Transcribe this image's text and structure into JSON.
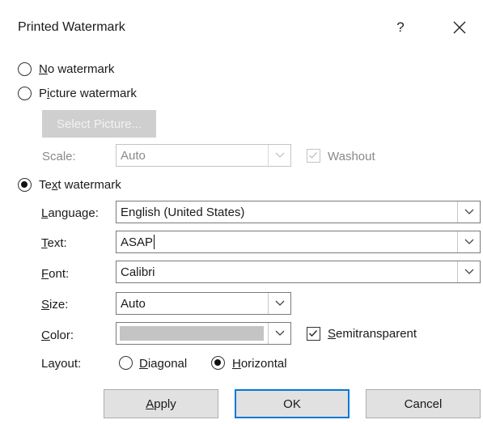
{
  "dialog": {
    "title": "Printed Watermark",
    "help_label": "?"
  },
  "options": {
    "no_watermark": {
      "label_key": "N",
      "label_rest": "o watermark",
      "selected": false
    },
    "picture_watermark": {
      "label_pre": "P",
      "label_key": "i",
      "label_rest": "cture watermark",
      "selected": false
    },
    "text_watermark": {
      "label_pre": "Te",
      "label_key": "x",
      "label_rest": "t watermark",
      "selected": true
    }
  },
  "picture": {
    "select_picture_label": "Select Picture...",
    "scale_label": "Scale:",
    "scale_value": "Auto",
    "washout_label": "Washout",
    "washout_checked": true
  },
  "text": {
    "language_label_key": "L",
    "language_label_rest": "anguage:",
    "language_value": "English (United States)",
    "text_label_key": "T",
    "text_label_rest": "ext:",
    "text_value": "ASAP",
    "font_label_key": "F",
    "font_label_rest": "ont:",
    "font_value": "Calibri",
    "size_label_key": "S",
    "size_label_rest": "ize:",
    "size_value": "Auto",
    "color_label_key": "C",
    "color_label_rest": "olor:",
    "color_value": "#c4c4c4",
    "semitransparent_key": "S",
    "semitransparent_rest": "emitransparent",
    "semitransparent_checked": true,
    "layout_label": "Layout:",
    "diagonal_key": "D",
    "diagonal_rest": "iagonal",
    "horizontal_key": "H",
    "horizontal_rest": "orizontal",
    "layout_selected": "horizontal"
  },
  "buttons": {
    "apply_key": "A",
    "apply_rest": "pply",
    "ok": "OK",
    "cancel": "Cancel"
  },
  "colors": {
    "accent": "#0078d7",
    "disabled_text": "#8a8a8a",
    "button_face": "#e1e1e1"
  }
}
